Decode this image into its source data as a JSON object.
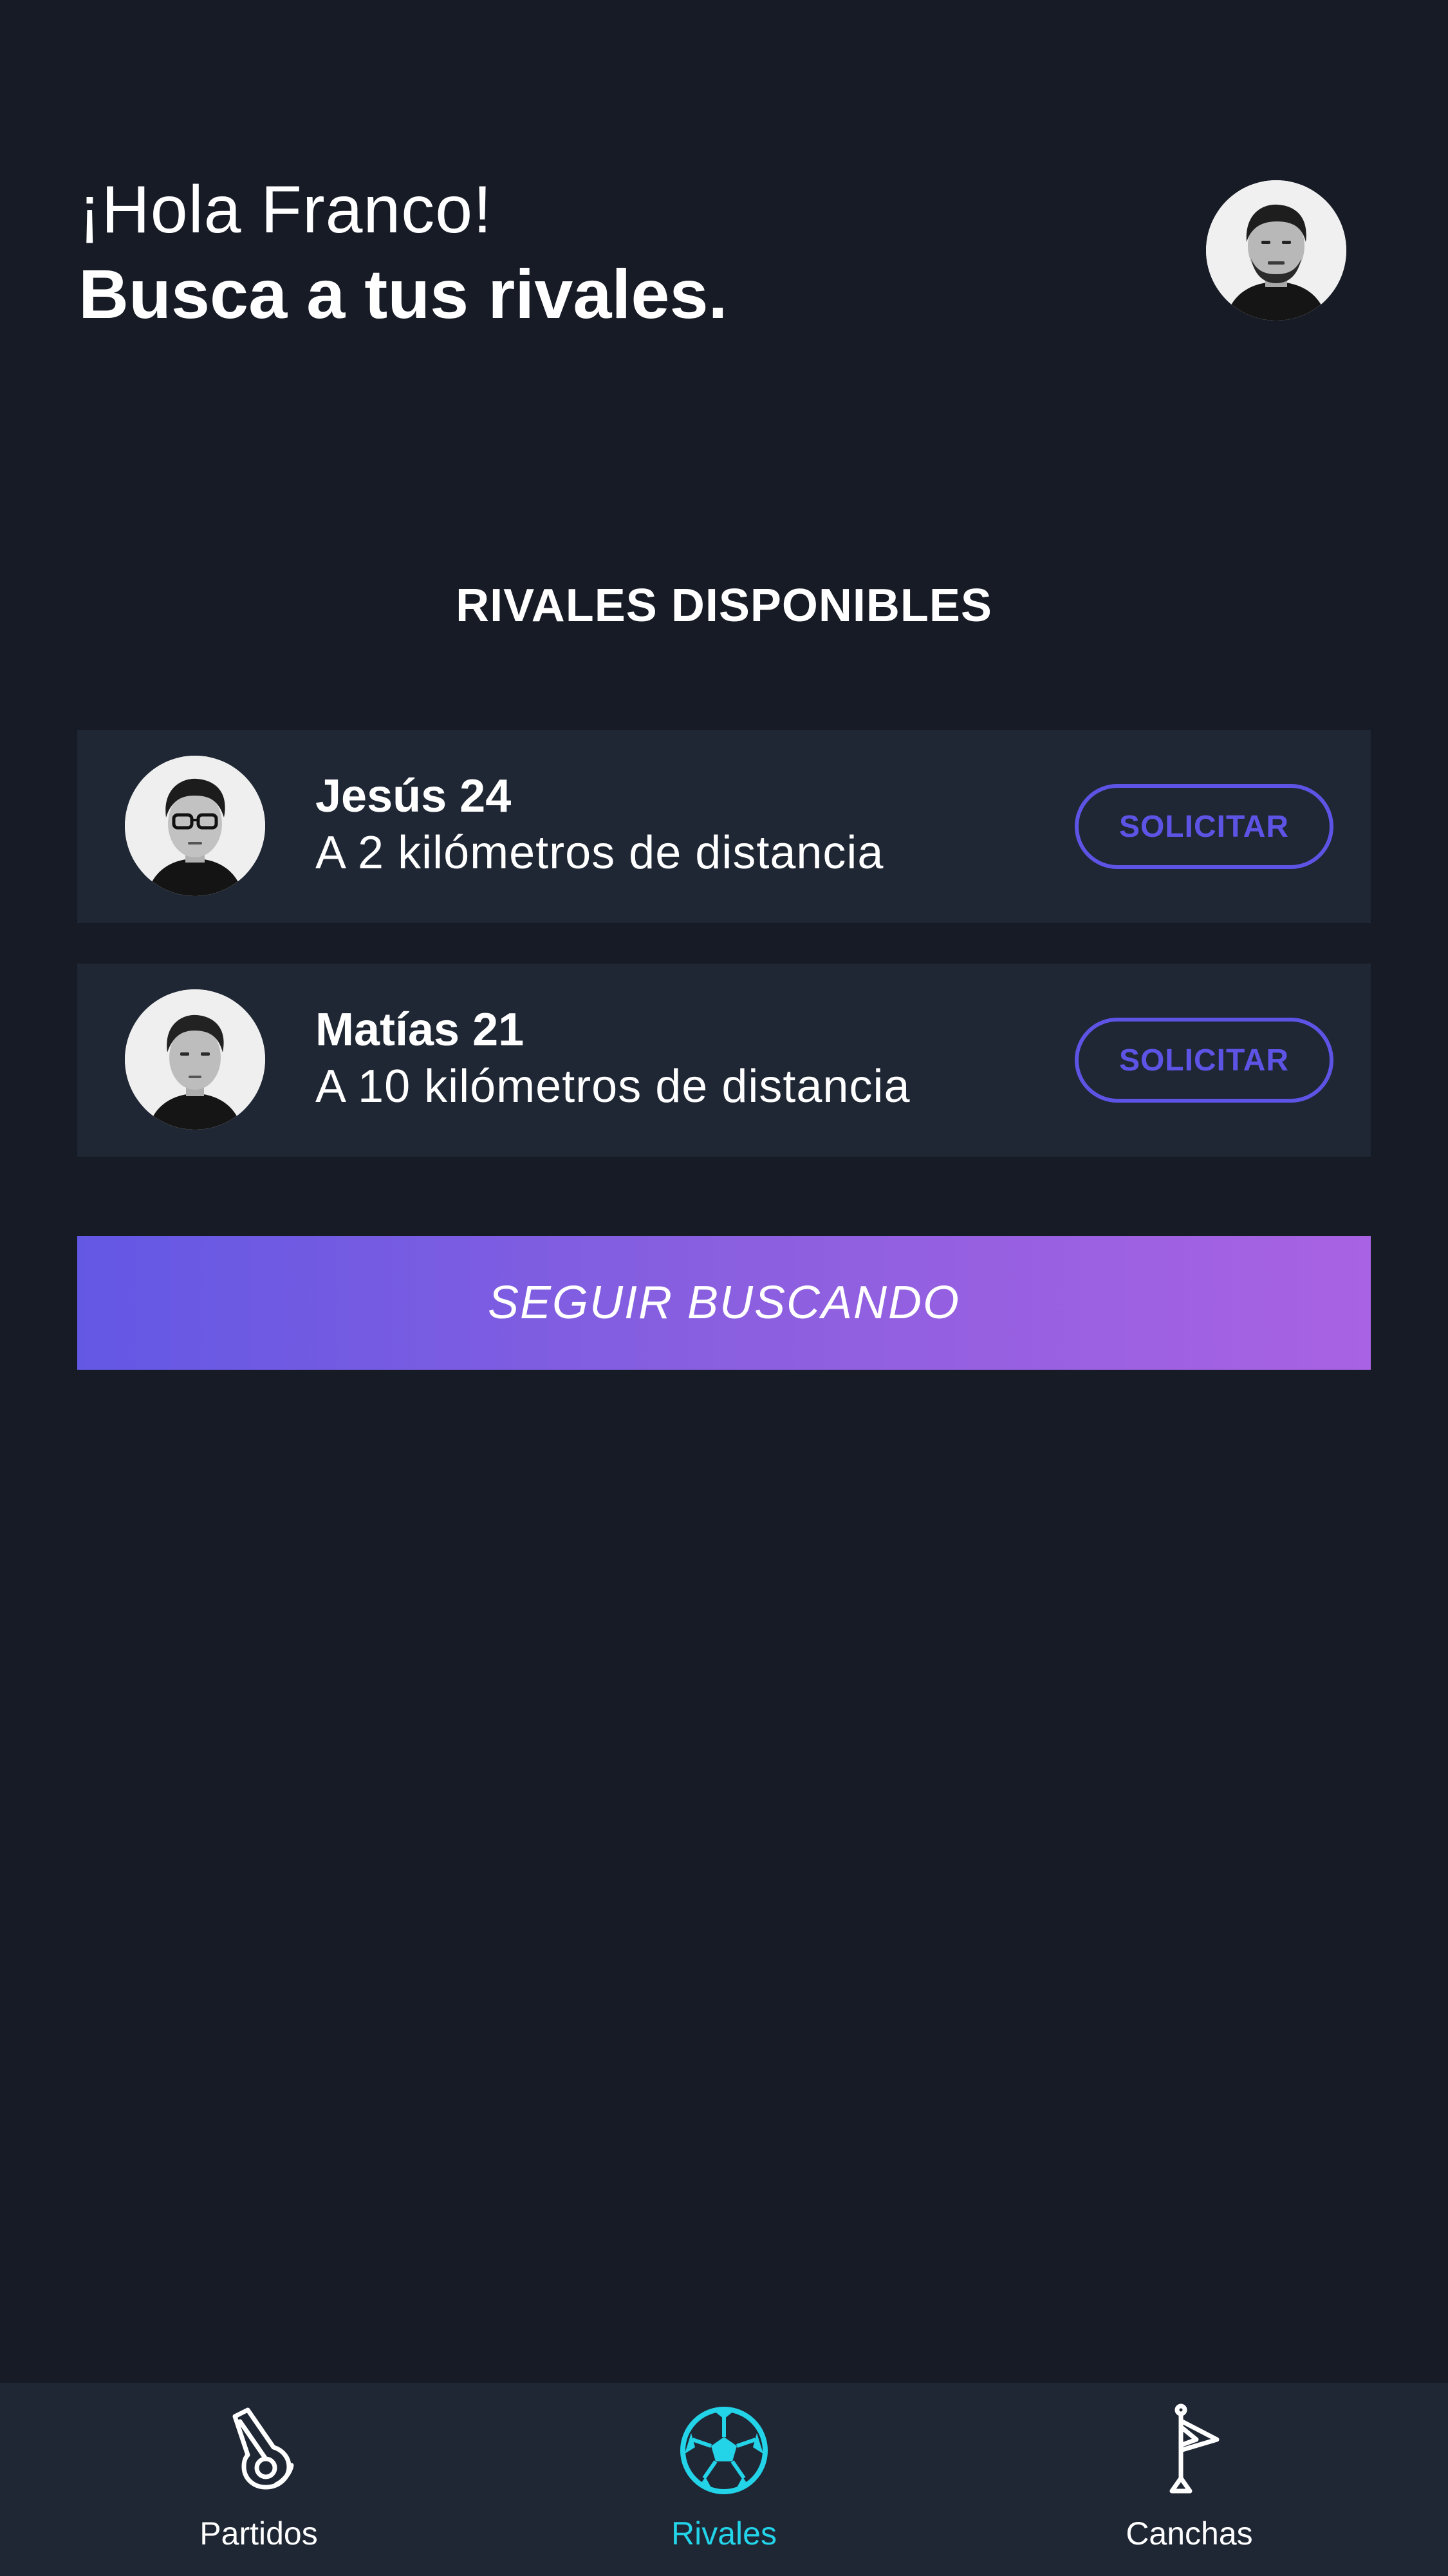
{
  "header": {
    "greeting": "¡Hola Franco!",
    "headline": "Busca a tus rivales."
  },
  "section": {
    "title": "RIVALES DISPONIBLES"
  },
  "rivals": [
    {
      "name": "Jesús 24",
      "distance": "A 2 kilómetros de distancia",
      "action": "SOLICITAR"
    },
    {
      "name": "Matías 21",
      "distance": "A 10 kilómetros de distancia",
      "action": "SOLICITAR"
    }
  ],
  "search_button": {
    "label": "SEGUIR BUSCANDO"
  },
  "bottom_nav": {
    "items": [
      {
        "label": "Partidos",
        "icon": "whistle-icon",
        "active": false
      },
      {
        "label": "Rivales",
        "icon": "soccer-ball-icon",
        "active": true
      },
      {
        "label": "Canchas",
        "icon": "corner-flag-icon",
        "active": false
      }
    ]
  },
  "colors": {
    "background": "#171b26",
    "card": "#1f2734",
    "accent": "#5d54e6",
    "gradient_start": "#6358e4",
    "gradient_end": "#a862e3",
    "active_tab": "#23d3e8"
  }
}
